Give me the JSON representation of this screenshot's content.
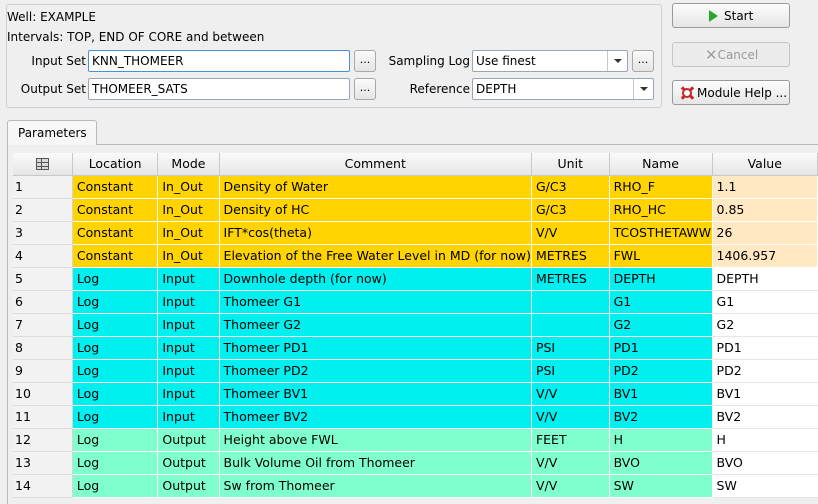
{
  "header": {
    "well_line": "Well: EXAMPLE",
    "intervals_line": "Intervals: TOP, END OF CORE and between"
  },
  "input_set": {
    "label": "Input Set",
    "value": "KNN_THOMEER",
    "browse": "..."
  },
  "output_set": {
    "label": "Output Set",
    "value": "THOMEER_SATS",
    "browse": "..."
  },
  "sampling_log": {
    "label": "Sampling Log",
    "value": "Use finest",
    "browse": "..."
  },
  "reference": {
    "label": "Reference",
    "value": "DEPTH"
  },
  "buttons": {
    "start": "Start",
    "cancel": "Cancel",
    "help": "Module Help ..."
  },
  "tab": {
    "label": "Parameters"
  },
  "colors": {
    "constant": "#ffd400",
    "log_input": "#00f0f0",
    "log_output": "#80ffce",
    "value_const": "#ffe8c2"
  },
  "table": {
    "columns": [
      "Location",
      "Mode",
      "Comment",
      "Unit",
      "Name",
      "Value"
    ],
    "rows": [
      {
        "n": "1",
        "location": "Constant",
        "mode": "In_Out",
        "comment": "Density of Water",
        "unit": "G/C3",
        "name": "RHO_F",
        "value": "1.1"
      },
      {
        "n": "2",
        "location": "Constant",
        "mode": "In_Out",
        "comment": "Density of HC",
        "unit": "G/C3",
        "name": "RHO_HC",
        "value": "0.85"
      },
      {
        "n": "3",
        "location": "Constant",
        "mode": "In_Out",
        "comment": "IFT*cos(theta)",
        "unit": "V/V",
        "name": "TCOSTHETAWW",
        "value": "26"
      },
      {
        "n": "4",
        "location": "Constant",
        "mode": "In_Out",
        "comment": "Elevation of the Free Water Level in MD (for now)",
        "unit": "METRES",
        "name": "FWL",
        "value": "1406.957"
      },
      {
        "n": "5",
        "location": "Log",
        "mode": "Input",
        "comment": "Downhole depth (for now)",
        "unit": "METRES",
        "name": "DEPTH",
        "value": "DEPTH"
      },
      {
        "n": "6",
        "location": "Log",
        "mode": "Input",
        "comment": "Thomeer G1",
        "unit": "",
        "name": "G1",
        "value": "G1"
      },
      {
        "n": "7",
        "location": "Log",
        "mode": "Input",
        "comment": "Thomeer G2",
        "unit": "",
        "name": "G2",
        "value": "G2"
      },
      {
        "n": "8",
        "location": "Log",
        "mode": "Input",
        "comment": "Thomeer PD1",
        "unit": "PSI",
        "name": "PD1",
        "value": "PD1"
      },
      {
        "n": "9",
        "location": "Log",
        "mode": "Input",
        "comment": "Thomeer PD2",
        "unit": "PSI",
        "name": "PD2",
        "value": "PD2"
      },
      {
        "n": "10",
        "location": "Log",
        "mode": "Input",
        "comment": "Thomeer BV1",
        "unit": "V/V",
        "name": "BV1",
        "value": "BV1"
      },
      {
        "n": "11",
        "location": "Log",
        "mode": "Input",
        "comment": "Thomeer BV2",
        "unit": "V/V",
        "name": "BV2",
        "value": "BV2"
      },
      {
        "n": "12",
        "location": "Log",
        "mode": "Output",
        "comment": "Height above FWL",
        "unit": "FEET",
        "name": "H",
        "value": "H"
      },
      {
        "n": "13",
        "location": "Log",
        "mode": "Output",
        "comment": "Bulk Volume Oil from Thomeer",
        "unit": "V/V",
        "name": "BVO",
        "value": "BVO"
      },
      {
        "n": "14",
        "location": "Log",
        "mode": "Output",
        "comment": "Sw from Thomeer",
        "unit": "V/V",
        "name": "SW",
        "value": "SW"
      }
    ]
  }
}
